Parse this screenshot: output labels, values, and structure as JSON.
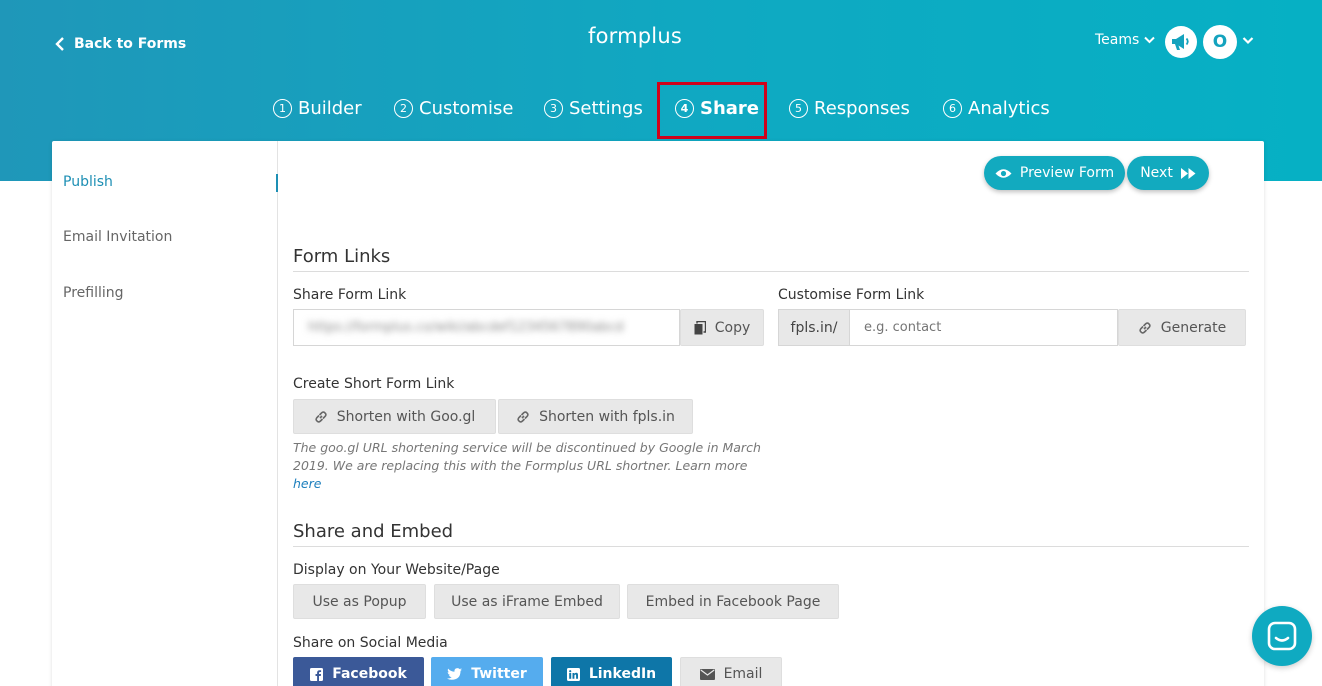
{
  "header": {
    "back_label": "Back to Forms",
    "logo_text": "formplus",
    "teams_label": "Teams",
    "avatar_initial": "O"
  },
  "tabs": [
    {
      "num": "1",
      "label": "Builder",
      "active": false
    },
    {
      "num": "2",
      "label": "Customise",
      "active": false
    },
    {
      "num": "3",
      "label": "Settings",
      "active": false
    },
    {
      "num": "4",
      "label": "Share",
      "active": true
    },
    {
      "num": "5",
      "label": "Responses",
      "active": false
    },
    {
      "num": "6",
      "label": "Analytics",
      "active": false
    }
  ],
  "sidebar": {
    "items": [
      {
        "label": "Publish",
        "active": true
      },
      {
        "label": "Email Invitation",
        "active": false
      },
      {
        "label": "Prefilling",
        "active": false
      }
    ]
  },
  "actions": {
    "preview_label": "Preview Form",
    "next_label": "Next"
  },
  "form_links": {
    "title": "Form Links",
    "share_label": "Share Form Link",
    "share_value": "https://formplus.co/wiki/abcdef1234567890abcd",
    "copy_label": "Copy",
    "customise_label": "Customise Form Link",
    "prefix": "fpls.in/",
    "custom_placeholder": "e.g. contact",
    "generate_label": "Generate",
    "short_label": "Create Short Form Link",
    "googl_label": "Shorten with Goo.gl",
    "fpls_label": "Shorten with fpls.in",
    "note_text": "The goo.gl URL shortening service will be discontinued by Google in March 2019. We are replacing this with the Formplus URL shortner. Learn more",
    "note_link": "here"
  },
  "share_embed": {
    "title": "Share and Embed",
    "display_label": "Display on Your Website/Page",
    "popup_label": "Use as Popup",
    "iframe_label": "Use as iFrame Embed",
    "facebook_page_label": "Embed in Facebook Page",
    "social_label": "Share on Social Media",
    "facebook_label": "Facebook",
    "twitter_label": "Twitter",
    "linkedin_label": "LinkedIn",
    "email_label": "Email"
  },
  "colors": {
    "brand_teal": "#12aabf",
    "active_link": "#1d8fb4",
    "highlight": "#d0021b",
    "facebook": "#3b5998",
    "twitter": "#55acee",
    "linkedin": "#0e76a8"
  },
  "icons": [
    "chevron-left-icon",
    "chevron-down-icon",
    "megaphone-icon",
    "eye-icon",
    "fast-forward-icon",
    "copy-icon",
    "link-icon",
    "facebook-icon",
    "twitter-icon",
    "linkedin-icon",
    "envelope-icon",
    "chat-icon"
  ]
}
